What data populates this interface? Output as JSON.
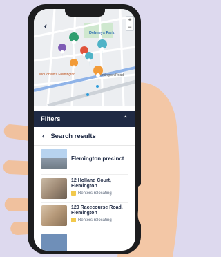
{
  "map": {
    "place_name": "Debneys Park",
    "mcdonalds": "McDonald's Flemington",
    "street": "Flemington Road"
  },
  "filters": {
    "label": "Filters"
  },
  "results_header": {
    "label": "Search results"
  },
  "results": [
    {
      "title": "Flemington precinct",
      "tag": ""
    },
    {
      "title": "12 Holland Court, Flemington",
      "tag": "Renters relocating"
    },
    {
      "title": "120 Racecourse Road, Flemington",
      "tag": "Renters relocating"
    }
  ],
  "colors": {
    "navy": "#1f2a44",
    "pin_green": "#2f9e6f",
    "pin_teal": "#4fb3c7",
    "pin_orange": "#f29b38",
    "pin_red": "#e0533b",
    "pin_purple": "#7e5bb5",
    "background": "#ddd9ee"
  },
  "icons": [
    "back-arrow-icon",
    "chevron-up-icon",
    "zoom-in-icon",
    "zoom-out-icon",
    "map-pin-icon",
    "renters-tag-icon"
  ]
}
